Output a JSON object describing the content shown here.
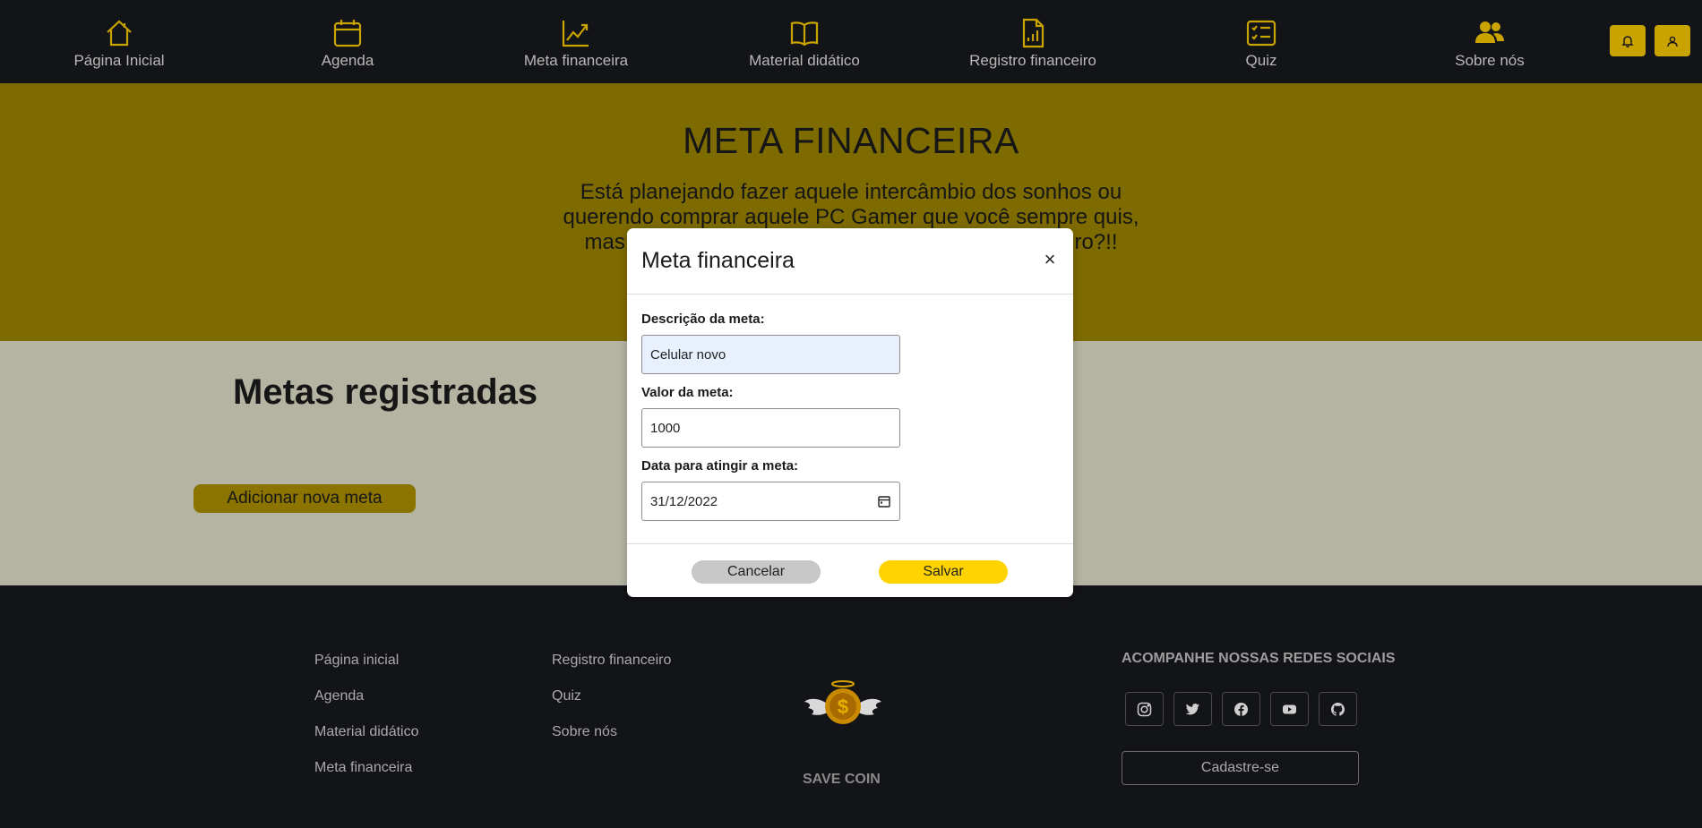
{
  "nav": {
    "items": [
      {
        "label": "Página Inicial",
        "icon": "home-icon"
      },
      {
        "label": "Agenda",
        "icon": "calendar-icon"
      },
      {
        "label": "Meta financeira",
        "icon": "chart-line-icon"
      },
      {
        "label": "Material didático",
        "icon": "book-icon"
      },
      {
        "label": "Registro financeiro",
        "icon": "file-chart-icon"
      },
      {
        "label": "Quiz",
        "icon": "checklist-icon"
      },
      {
        "label": "Sobre nós",
        "icon": "people-icon"
      }
    ],
    "accent_color": "#c9a300",
    "actions": [
      {
        "icon": "bell-icon"
      },
      {
        "icon": "user-icon"
      }
    ]
  },
  "hero": {
    "title": "META FINANCEIRA",
    "text": "Está planejando fazer aquele intercâmbio dos sonhos ou querendo comprar aquele PC Gamer que você sempre quis, mas não sabe como se organizar para juntar dinheiro?!!"
  },
  "metas": {
    "title": "Metas registradas",
    "add_button": "Adicionar nova meta"
  },
  "modal": {
    "title": "Meta financeira",
    "close_symbol": "×",
    "fields": {
      "descricao_label": "Descrição da meta:",
      "descricao_value": "Celular novo",
      "valor_label": "Valor da meta:",
      "valor_value": "1000",
      "data_label": "Data para atingir a meta:",
      "data_value": "31/12/2022"
    },
    "cancel_label": "Cancelar",
    "save_label": "Salvar"
  },
  "footer": {
    "col1": [
      "Página inicial",
      "Agenda",
      "Material didático",
      "Meta financeira"
    ],
    "col2": [
      "Registro financeiro",
      "Quiz",
      "Sobre nós"
    ],
    "brand": "SAVE COIN",
    "social_title": "ACOMPANHE NOSSAS REDES SOCIAIS",
    "social_icons": [
      "instagram-icon",
      "twitter-icon",
      "facebook-icon",
      "youtube-icon",
      "github-icon"
    ],
    "signup_label": "Cadastre-se"
  }
}
